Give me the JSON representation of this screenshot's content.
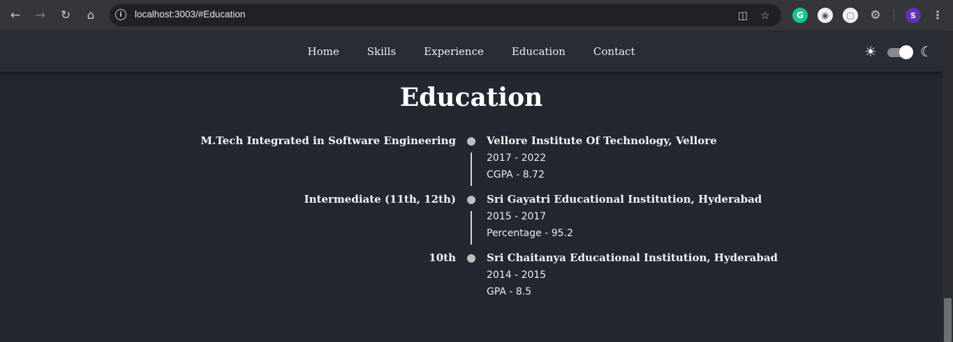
{
  "browser": {
    "url": "localhost:3003/#Education",
    "profile_initial": "S",
    "icons": {
      "back": "arrow-left-icon",
      "forward": "arrow-right-icon",
      "reload": "reload-icon",
      "home": "home-icon",
      "site_info": "info-icon",
      "install": "install-app-icon",
      "bookmark": "star-icon",
      "menu": "kebab-menu-icon"
    },
    "colors": {
      "chrome_bg": "#35363a",
      "omnibox_bg": "#202124",
      "profile": "#5e35b1",
      "grammarly": "#15c39a"
    }
  },
  "header": {
    "nav": [
      "Home",
      "Skills",
      "Experience",
      "Education",
      "Contact"
    ],
    "theme_toggle": {
      "light_icon": "sun-icon",
      "dark_icon": "moon-icon",
      "state": "dark"
    }
  },
  "education": {
    "title": "Education",
    "entries": [
      {
        "degree": "M.Tech Integrated in Software Engineering",
        "institution": "Vellore Institute Of Technology, Vellore",
        "years": "2017 - 2022",
        "score": "CGPA - 8.72"
      },
      {
        "degree": "Intermediate (11th, 12th)",
        "institution": "Sri Gayatri Educational Institution, Hyderabad",
        "years": "2015 - 2017",
        "score": "Percentage - 95.2"
      },
      {
        "degree": "10th",
        "institution": "Sri Chaitanya Educational Institution, Hyderabad",
        "years": "2014 - 2015",
        "score": "GPA - 8.5"
      }
    ]
  },
  "colors": {
    "page_bg": "#23272f",
    "header_bg": "#282c34",
    "text": "#ffffff",
    "timeline_dot": "#bfbfbf"
  }
}
